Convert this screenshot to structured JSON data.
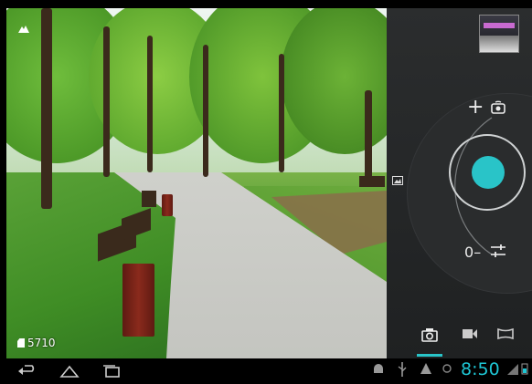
{
  "viewfinder": {
    "exposure_icon": "mountain-icon",
    "shots_remaining": "5710",
    "storage_icon": "sd-card-icon"
  },
  "panel": {
    "zoom_in": "+",
    "exposure_value": "0",
    "exposure_minus": "–",
    "accent_color": "#29c4c8",
    "modes": {
      "photo": "camera-icon",
      "video": "video-icon",
      "panorama": "panorama-icon"
    }
  },
  "navbar": {
    "back": "back-icon",
    "home": "home-icon",
    "recent": "recent-apps-icon"
  },
  "statusbar": {
    "time": "8:50",
    "time_color": "#1ec6d4"
  }
}
